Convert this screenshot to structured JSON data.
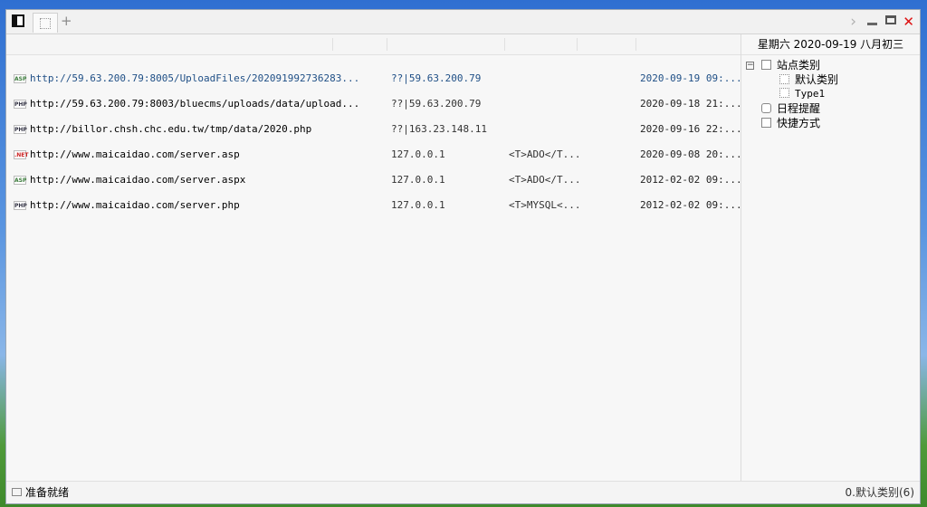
{
  "window": {
    "add_tab": "+",
    "close_glyph": "✕",
    "chevron_glyph": "›"
  },
  "header_date": "星期六 2020-09-19 八月初三",
  "rows": [
    {
      "type": "ASP",
      "url": "http://59.63.200.79:8005/UploadFiles/202091992736283...",
      "ip": "??|59.63.200.79",
      "data": "",
      "date": "2020-09-19 09:..."
    },
    {
      "type": "PHP",
      "url": "http://59.63.200.79:8003/bluecms/uploads/data/upload...",
      "ip": "??|59.63.200.79",
      "data": "",
      "date": "2020-09-18 21:..."
    },
    {
      "type": "PHP",
      "url": "http://billor.chsh.chc.edu.tw/tmp/data/2020.php",
      "ip": "??|163.23.148.11",
      "data": "",
      "date": "2020-09-16 22:..."
    },
    {
      "type": ".NET",
      "url": "http://www.maicaidao.com/server.asp",
      "ip": "127.0.0.1",
      "data": "<T>ADO</T...",
      "date": "2020-09-08 20:..."
    },
    {
      "type": "ASP",
      "url": "http://www.maicaidao.com/server.aspx",
      "ip": "127.0.0.1",
      "data": "<T>ADO</T...",
      "date": "2012-02-02 09:..."
    },
    {
      "type": "PHP",
      "url": "http://www.maicaidao.com/server.php",
      "ip": "127.0.0.1",
      "data": "<T>MYSQL<...",
      "date": "2012-02-02 09:..."
    }
  ],
  "tree": {
    "toggle": "−",
    "root": "站点类别",
    "children": [
      "默认类别",
      "Type1"
    ],
    "schedule": "日程提醒",
    "shortcuts": "快捷方式"
  },
  "status": {
    "left": "准备就绪",
    "right": "0.默认类别(6)"
  }
}
